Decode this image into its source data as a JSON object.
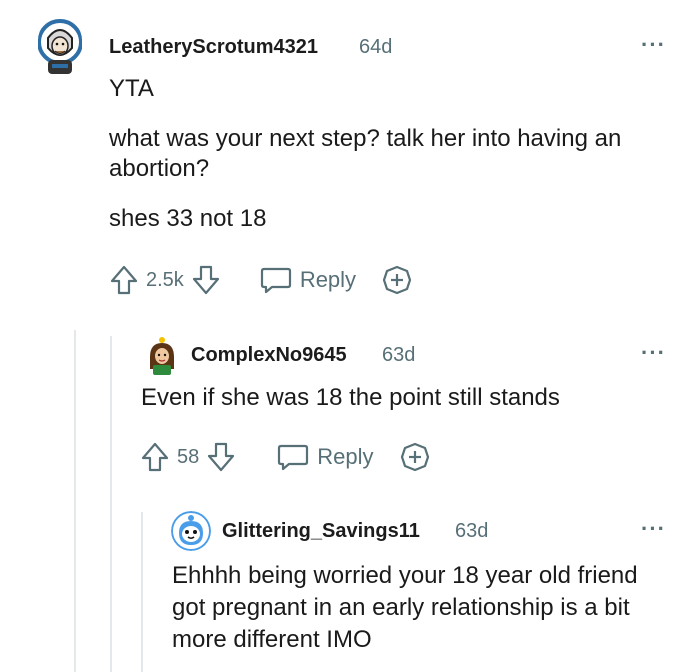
{
  "comments": [
    {
      "username": "LeatheryScrotum4321",
      "age": "64d",
      "paragraphs": [
        "YTA",
        "what was your next step? talk her into having an abortion?",
        "shes 33 not 18"
      ],
      "votes": "2.5k",
      "reply_label": "Reply"
    },
    {
      "username": "ComplexNo9645",
      "age": "63d",
      "paragraphs": [
        "Even if she was 18 the point still stands"
      ],
      "votes": "58",
      "reply_label": "Reply"
    },
    {
      "username": "Glittering_Savings11",
      "age": "63d",
      "paragraphs": [
        "Ehhhh being worried your 18 year old friend got pregnant in an early relationship is a bit more different IMO"
      ]
    }
  ],
  "more_icon": "more-horizontal-icon",
  "colors": {
    "meta": "#576f76",
    "text": "#1a1a1b",
    "thread_line": "#e3e8ea"
  }
}
